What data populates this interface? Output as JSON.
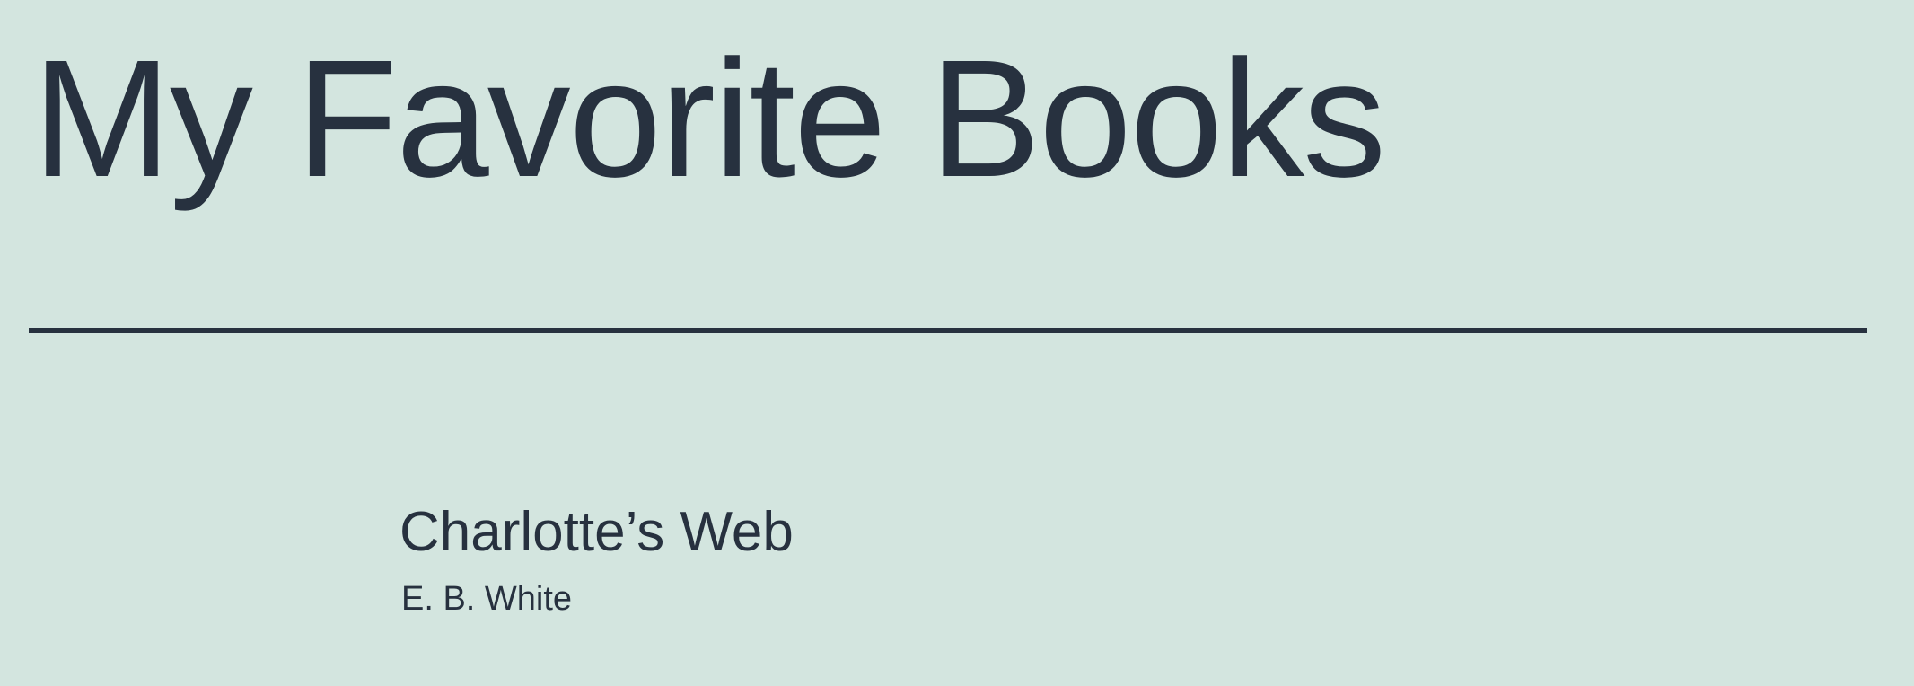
{
  "page": {
    "title": "My Favorite Books"
  },
  "books": [
    {
      "title": "Charlotte’s Web",
      "author": "E. B. White"
    }
  ],
  "colors": {
    "background": "#d3e5df",
    "text": "#27313f",
    "divider": "#27313f"
  }
}
